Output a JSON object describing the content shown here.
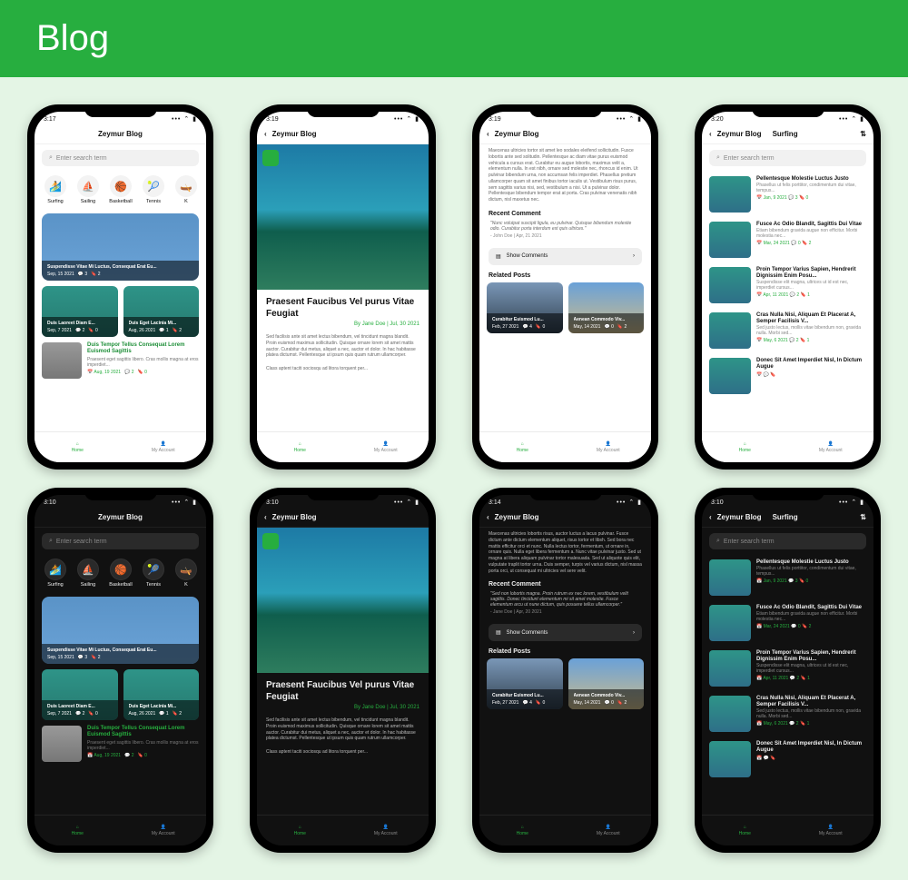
{
  "header_title": "Blog",
  "app_title": "Zeymur Blog",
  "search_placeholder": "Enter search term",
  "status_times": {
    "s1": "3:17",
    "s2": "3:19",
    "s3": "3:19",
    "s4": "3:20",
    "s5": "3:10",
    "s6": "3:10",
    "s7": "3:14",
    "s8": "3:10"
  },
  "categories": [
    {
      "label": "Surfing",
      "icon": "🏄"
    },
    {
      "label": "Sailing",
      "icon": "⛵"
    },
    {
      "label": "Basketball",
      "icon": "🏀"
    },
    {
      "label": "Tennis",
      "icon": "🎾"
    },
    {
      "label": "K",
      "icon": "🛶"
    }
  ],
  "home_hero": {
    "title": "Suspendisse Vitae Mi Luctus, Consequat Erat Eu...",
    "date": "Sep, 15 2021",
    "comments": "3",
    "bookmarks": "2"
  },
  "home_pair": [
    {
      "title": "Duis Laoreet Diam E...",
      "date": "Sep, 7 2021",
      "comments": "2",
      "bookmarks": "0"
    },
    {
      "title": "Duis Eget Lacinia Mi...",
      "date": "Aug, 26 2021",
      "comments": "1",
      "bookmarks": "2"
    }
  ],
  "home_list_item": {
    "title": "Duis Tempor Tellus Consequat Lorem Euismod Sagittis",
    "desc": "Praesent eget sagittis libero. Cras mollis magna at eros imperdiet...",
    "date": "Aug, 19 2021",
    "comments": "2",
    "bookmarks": "0"
  },
  "detail": {
    "title": "Praesent Faucibus Vel purus Vitae Feugiat",
    "byline": "By Jane Doe | Jul, 30 2021",
    "p1": "Sed facilisis ante sit amet lectus bibendum, vel tincidunt magna blandit. Proin euismod maximus sollicitudin. Quisque ornare lorem sit amet mattis auctor. Curabitur dui metus, aliquet a nec, auctor et dolor. In hac habitasse platea dictumst. Pellentesque ut ipsum quis quam rutrum ullamcorper.",
    "p2": "Class aptent taciti sociosqu ad litora torquent per..."
  },
  "article": {
    "body": "Maecenas ultricies tortor sit amet leo sodales eleifend sollicitudin. Fusce lobortis ante sed solitudin. Pellentesque ac diam vitae purus euismod vehicula a cursus erat. Curabitur eu augue lobortis, maximus velit a, elementum nulla. In est nibh, ornare sed molestie nec, rhoncus id enim. Ut pulvinar bibendum urna, non accumsan felis imperdiet. Phasellus pretium ullamcorper quam sit amet finibus tortor iaculis ut. Vestibulum risus purus, sem sagittis varius nisi, sed, vestibulum a nisi. Ut a pulvinar dolor. Pellentesque bibendum tempor erat at porta. Cras pulvinar venenatis nibh dictum, nisl maxetus nec.",
    "recent_comment_label": "Recent Comment",
    "quote": "\"Nunc volutpat suscipit ligula, eu pulvinar. Quisque bibendum molestie odio. Curabitur porta interdum est quis ultrices.\"",
    "quote_by": "- John Doe | Apr, 21 2021",
    "show_comments": "Show Comments",
    "related_label": "Related Posts",
    "related": [
      {
        "title": "Curabitur Euismod Lu...",
        "date": "Feb, 27 2021",
        "comments": "4",
        "bookmarks": "0"
      },
      {
        "title": "Aenean Commodo Viv...",
        "date": "May, 14 2021",
        "comments": "0",
        "bookmarks": "2"
      }
    ]
  },
  "article_dark": {
    "body": "Maecenas ultricies lobortis risus, auctor luctus a lacus pulvinar. Fusce dictum ante dictum elementum aliquet, risus tortor et libsh. Sed bora nec mattis efficitur orci et nunc. Nulla lectus tortor, fermentum, ut ornare in, ornare quis. Nulla eget libera fermentum a. Nunc vitae pulvinar justo. Sed ut magna at libera aliquam pulvinar tortor malesuada. Sed ut aliquote quis elit, vulputate traplit tortor urna. Duis semper, turpis vel varius dictum, nisl massa porta orci, ut consequat mi ultricies vel sere velit.",
    "quote": "\"Sed non lobortis magna. Proin rutrum ex nec lorem, vestibulum velit sagittis. Donec tincidunt elementum mi sit amet molestie. Fusce elementum arcu ut nune dictum, quis posuere tellus ullamcorper.\"",
    "quote_by": "- Jane Doe | Apr, 20 2021"
  },
  "surfing": {
    "title": "Surfing",
    "items": [
      {
        "title": "Pellentesque Molestie Luctus Justo",
        "desc": "Phasellus ut felis porttitor, condimentum dui vitae, tempus...",
        "date": "Jan, 9 2021",
        "c": "3",
        "b": "0"
      },
      {
        "title": "Fusce Ac Odio Blandit, Sagittis Dui Vitae",
        "desc": "Etiam bibendum gravida augue non efficitur. Morbi molestia nec...",
        "date": "Mar, 24 2021",
        "c": "0",
        "b": "2"
      },
      {
        "title": "Proin Tempor Varius Sapien, Hendrerit Dignissim Enim Posu...",
        "desc": "Suspendisse elit magna, ultrices ut id est nec, imperdiet cursus...",
        "date": "Apr, 11 2021",
        "c": "2",
        "b": "1"
      },
      {
        "title": "Cras Nulla Nisi, Aliquam Et Placerat A, Semper Facilisis V...",
        "desc": "Sed justo lectus, mollis vitae bibendum non, gravida nulla. Morbi sed...",
        "date": "May, 6 2021",
        "c": "2",
        "b": "1"
      },
      {
        "title": "Donec Sit Amet Imperdiet Nisl, In Dictum Augue",
        "desc": "",
        "date": "",
        "c": "",
        "b": ""
      }
    ]
  },
  "tabs": {
    "home": "Home",
    "account": "My Account"
  }
}
